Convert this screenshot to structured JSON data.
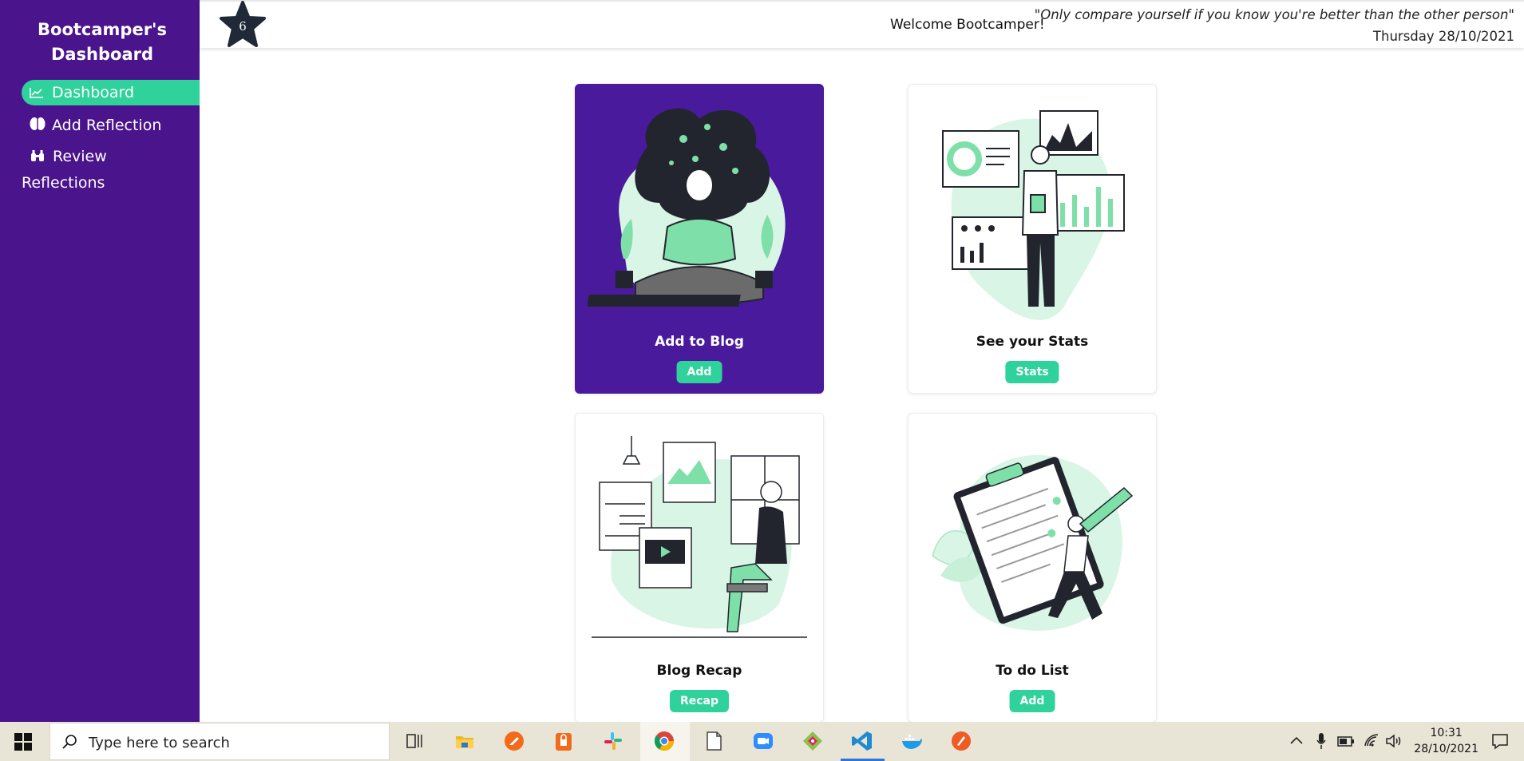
{
  "sidebar": {
    "brand": "Bootcamper's Dashboard",
    "items": [
      {
        "label": "Dashboard",
        "icon": "chart-line-icon",
        "active": true
      },
      {
        "label": "Add Reflection",
        "icon": "brain-icon",
        "active": false
      },
      {
        "label": "Review Reflections",
        "icon": "binoculars-icon",
        "active": false
      }
    ]
  },
  "topbar": {
    "star_count": "6",
    "welcome": "Welcome Bootcamper!",
    "quote": "\"Only compare yourself if you know you're better than the other person\"",
    "date": "Thursday 28/10/2021"
  },
  "cards": [
    {
      "title": "Add to Blog",
      "button": "Add",
      "theme": "#4a1a9c"
    },
    {
      "title": "See your Stats",
      "button": "Stats",
      "theme": "#ffffff"
    },
    {
      "title": "Blog Recap",
      "button": "Recap",
      "theme": "#ffffff"
    },
    {
      "title": "To do List",
      "button": "Add",
      "theme": "#ffffff"
    }
  ],
  "taskbar": {
    "search_placeholder": "Type here to search",
    "time": "10:31",
    "date": "28/10/2021",
    "apps": [
      "task-view-icon",
      "file-explorer-icon",
      "postman-icon",
      "password-manager-icon",
      "slack-icon",
      "chrome-icon",
      "notepad-icon",
      "zoom-icon",
      "git-icon",
      "vscode-icon",
      "docker-icon",
      "postman-alt-icon"
    ]
  },
  "colors": {
    "sidebar": "#4a148c",
    "accent": "#2fd29a",
    "taskbar": "#e9e5d6"
  }
}
